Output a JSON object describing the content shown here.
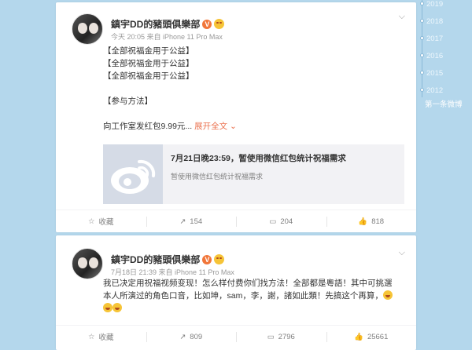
{
  "timeline": {
    "years": [
      "2019",
      "2018",
      "2017",
      "2016",
      "2015",
      "2012"
    ],
    "first_post_label": "第一条微博"
  },
  "posts": [
    {
      "author": "鎮宇DD的豬頭俱樂部",
      "verified_badge": "V",
      "meta": "今天 20:05 来自 iPhone 11 Pro Max",
      "lines": [
        "【全部祝福金用于公益】",
        "【全部祝福金用于公益】",
        "【全部祝福金用于公益】",
        "",
        "【参与方法】",
        "",
        "向工作室发红包9.99元..."
      ],
      "expand_label": "展开全文",
      "link_card": {
        "title": "7月21日晚23:59，暂使用微信红包统计祝福需求",
        "description": "暂使用微信红包统计祝福需求"
      },
      "actions": {
        "favorite": "收藏",
        "repost": "154",
        "comment": "204",
        "like": "818"
      }
    },
    {
      "author": "鎮宇DD的豬頭俱樂部",
      "verified_badge": "V",
      "meta": "7月18日 21:39 来自 iPhone 11 Pro Max",
      "lines": [
        "我已决定用祝福视频变现！怎么样付费你们找方法！全部都是粵語！其中可挑選",
        "本人所演过的角色口音，比如坤，sam，李，謝，諸如此類！先搞这个再算，"
      ],
      "actions": {
        "favorite": "收藏",
        "repost": "809",
        "comment": "2796",
        "like": "25661"
      }
    }
  ],
  "colors": {
    "page_bg": "#b4d7ec",
    "link_orange": "#eb7350",
    "badge_orange": "#f1763a"
  }
}
